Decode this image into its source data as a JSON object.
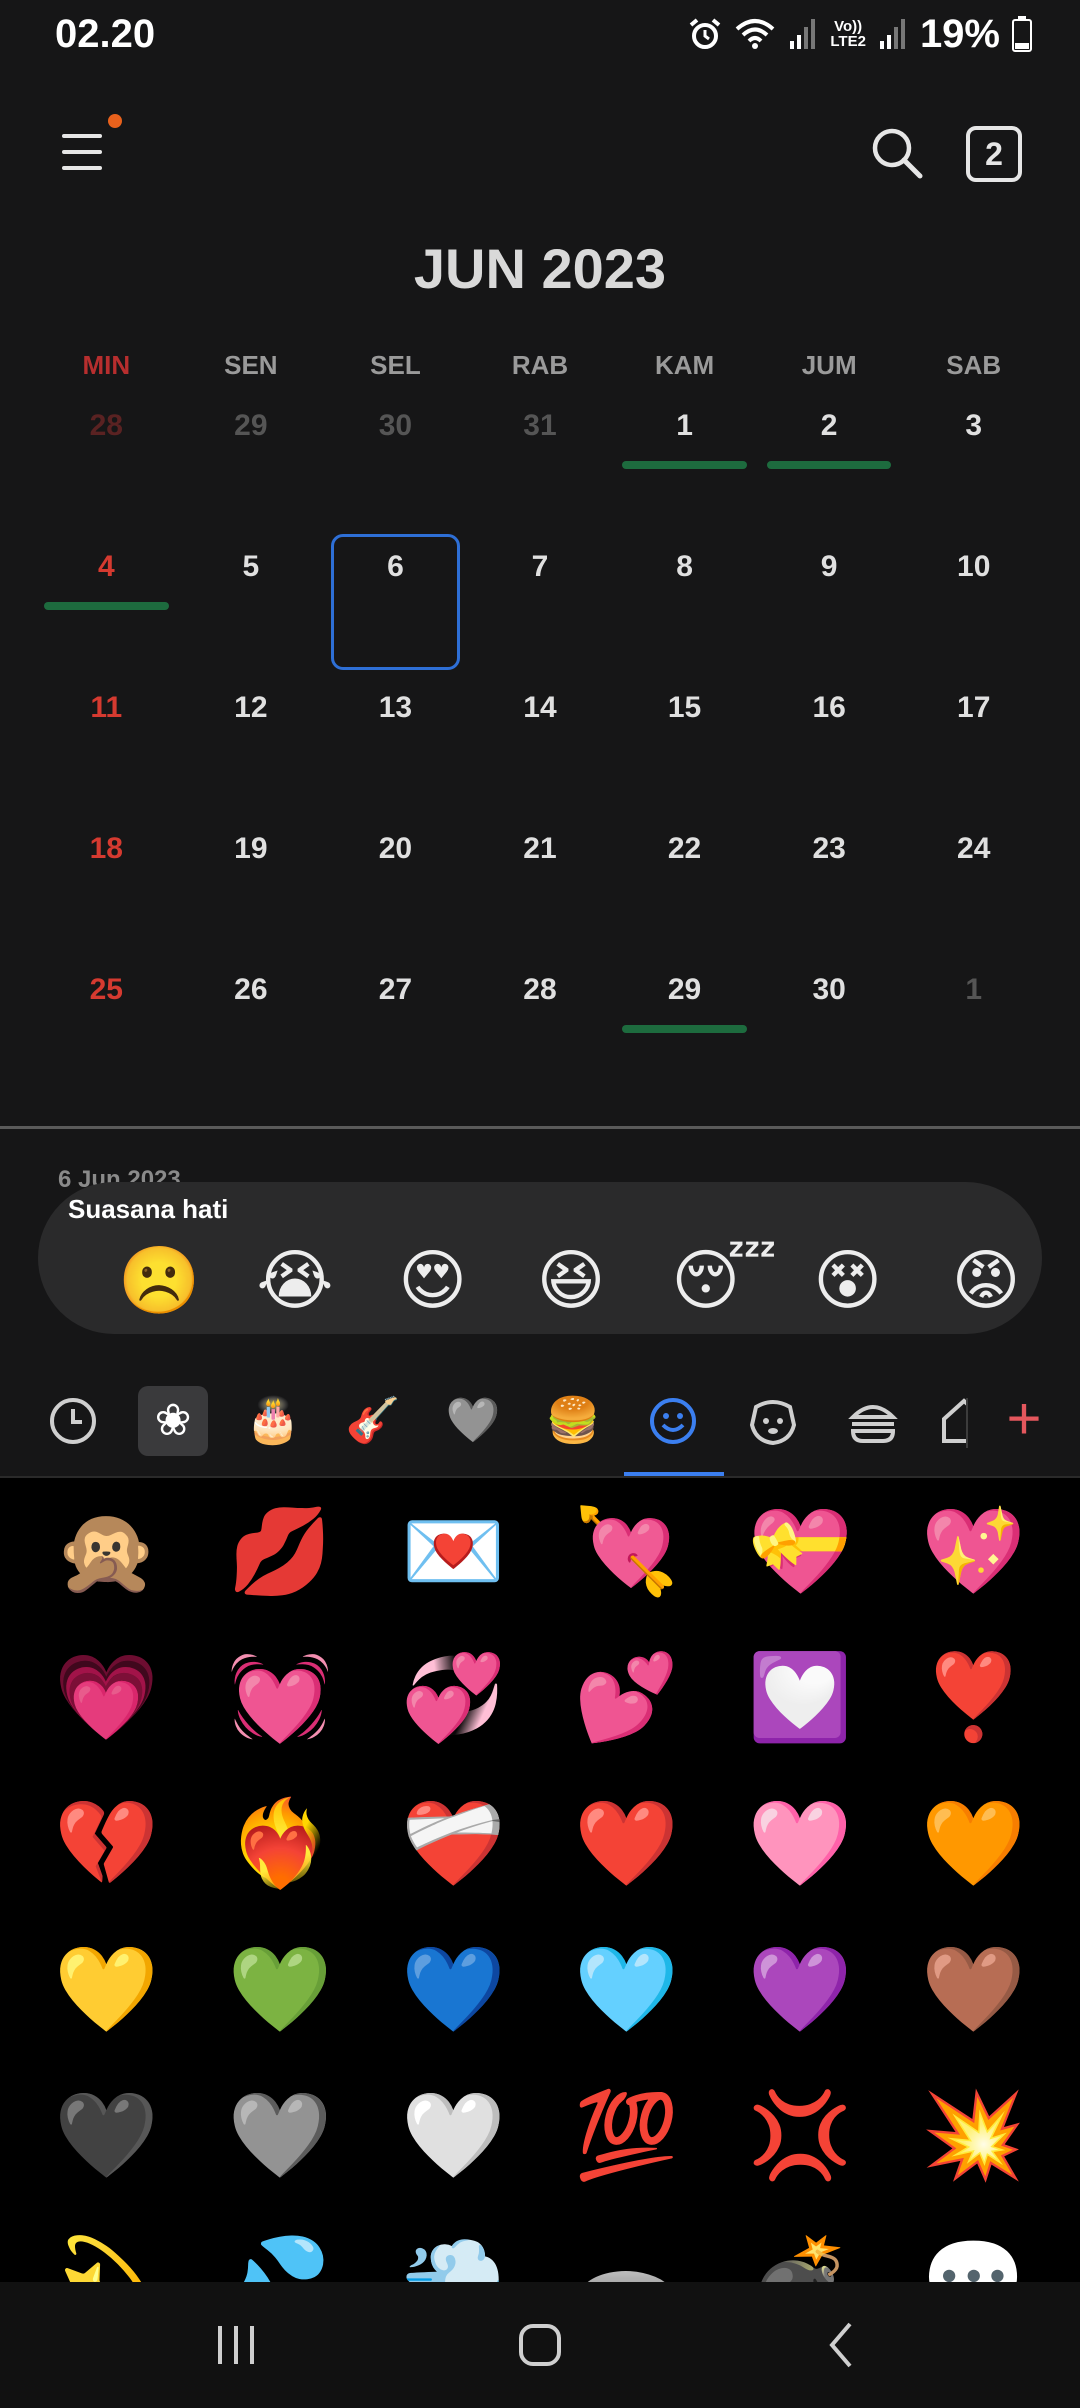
{
  "status": {
    "time": "02.20",
    "battery": "19%",
    "lte_top": "Vo))",
    "lte_bottom": "LTE2"
  },
  "header": {
    "month_title": "JUN 2023",
    "tab_count": "2"
  },
  "weekdays": [
    "MIN",
    "SEN",
    "SEL",
    "RAB",
    "KAM",
    "JUM",
    "SAB"
  ],
  "weeks": [
    [
      "28",
      "29",
      "30",
      "31",
      "1",
      "2",
      "3"
    ],
    [
      "4",
      "5",
      "6",
      "7",
      "8",
      "9",
      "10"
    ],
    [
      "11",
      "12",
      "13",
      "14",
      "15",
      "16",
      "17"
    ],
    [
      "18",
      "19",
      "20",
      "21",
      "22",
      "23",
      "24"
    ],
    [
      "25",
      "26",
      "27",
      "28",
      "29",
      "30",
      "1"
    ]
  ],
  "selected_date_label": "6 Jun 2023",
  "mood": {
    "title": "Suasana hati",
    "emojis": [
      "☹️",
      "😭",
      "😍",
      "😆",
      "😴",
      "😵",
      "😡"
    ]
  },
  "keyboard": {
    "tabs": [
      "recent",
      "stickers",
      "cake",
      "guitar",
      "heart",
      "burger",
      "smileys",
      "pets",
      "food",
      "objects"
    ],
    "tab_glyphs": [
      "🕒",
      "❀",
      "🎂",
      "🎸",
      "🩶",
      "🍔",
      "☺",
      "🐶",
      "🍔",
      "🏠"
    ],
    "add_label": "+",
    "emojis": [
      "🙊",
      "💋",
      "💌",
      "💘",
      "💝",
      "💖",
      "💗",
      "💓",
      "💞",
      "💕",
      "💟",
      "❣️",
      "💔",
      "❤️‍🔥",
      "❤️‍🩹",
      "❤️",
      "🩷",
      "🧡",
      "💛",
      "💚",
      "💙",
      "🩵",
      "💜",
      "🤎",
      "🖤",
      "🩶",
      "🤍",
      "💯",
      "💢",
      "💥",
      "💫",
      "💦",
      "💨",
      "🕳️",
      "💣",
      "💬"
    ]
  }
}
